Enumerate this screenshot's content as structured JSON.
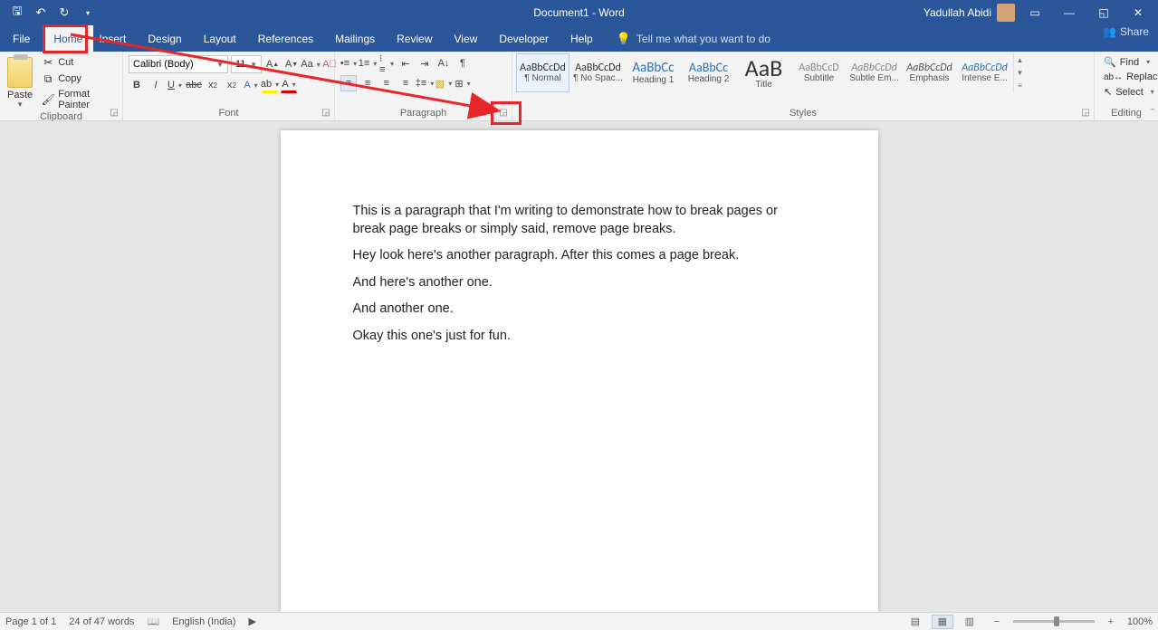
{
  "titlebar": {
    "doc_title": "Document1  -  Word",
    "user_name": "Yadullah Abidi"
  },
  "tabs": {
    "file": "File",
    "home": "Home",
    "insert": "Insert",
    "design": "Design",
    "layout": "Layout",
    "references": "References",
    "mailings": "Mailings",
    "review": "Review",
    "view": "View",
    "developer": "Developer",
    "help": "Help",
    "tellme": "Tell me what you want to do",
    "share": "Share"
  },
  "ribbon": {
    "clipboard": {
      "label": "Clipboard",
      "paste": "Paste",
      "cut": "Cut",
      "copy": "Copy",
      "format_painter": "Format Painter"
    },
    "font": {
      "label": "Font",
      "name": "Calibri (Body)",
      "size": "11"
    },
    "paragraph": {
      "label": "Paragraph"
    },
    "styles": {
      "label": "Styles",
      "items": [
        {
          "preview": "AaBbCcDd",
          "label": "¶ Normal",
          "size": "12px",
          "color": "#333",
          "selected": true
        },
        {
          "preview": "AaBbCcDd",
          "label": "¶ No Spac...",
          "size": "12px",
          "color": "#333"
        },
        {
          "preview": "AaBbCc",
          "label": "Heading 1",
          "size": "15px",
          "color": "#2e74b5"
        },
        {
          "preview": "AaBbCc",
          "label": "Heading 2",
          "size": "14px",
          "color": "#2e74b5"
        },
        {
          "preview": "AaB",
          "label": "Title",
          "size": "26px",
          "color": "#333"
        },
        {
          "preview": "AaBbCcD",
          "label": "Subtitle",
          "size": "12px",
          "color": "#888"
        },
        {
          "preview": "AaBbCcDd",
          "label": "Subtle Em...",
          "size": "12px",
          "color": "#888",
          "italic": true
        },
        {
          "preview": "AaBbCcDd",
          "label": "Emphasis",
          "size": "12px",
          "color": "#555",
          "italic": true
        },
        {
          "preview": "AaBbCcDd",
          "label": "Intense E...",
          "size": "12px",
          "color": "#2e74b5",
          "italic": true
        }
      ]
    },
    "editing": {
      "label": "Editing",
      "find": "Find",
      "replace": "Replace",
      "select": "Select"
    }
  },
  "document": {
    "p1": "This is a paragraph that I'm writing to demonstrate how to break pages or break page breaks or simply said, remove page breaks.",
    "p2": "Hey look here's another paragraph. After this comes a page break.",
    "p3": "And here's another one.",
    "p4": "And another one.",
    "p5": "Okay this one's just for fun."
  },
  "statusbar": {
    "page": "Page 1 of 1",
    "words": "24 of 47 words",
    "language": "English (India)",
    "zoom": "100%"
  }
}
